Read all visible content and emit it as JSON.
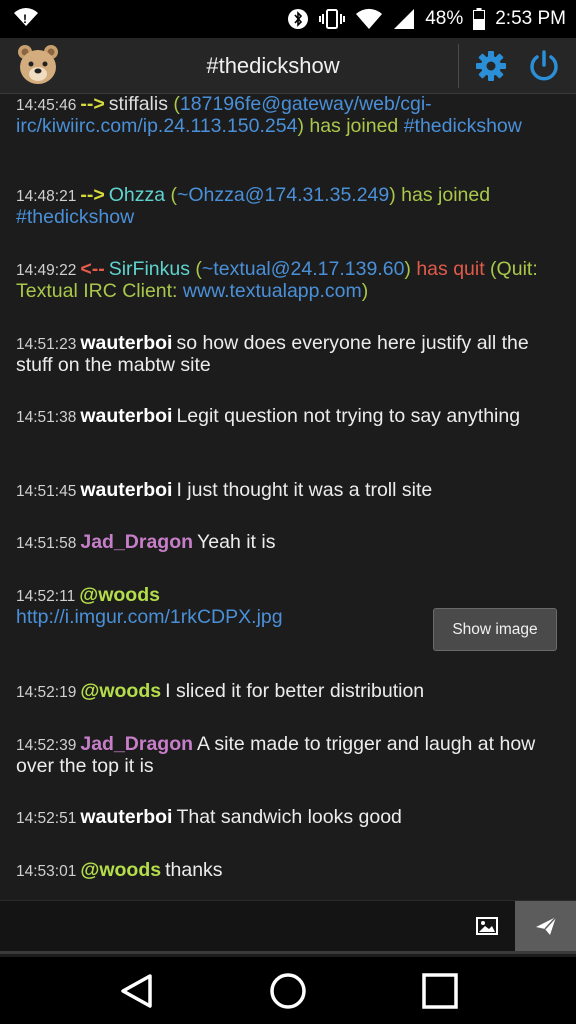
{
  "status_bar": {
    "battery": "48%",
    "time": "2:53 PM",
    "icons": [
      "wifi-icon",
      "bluetooth-icon",
      "vibrate-icon",
      "signal-wifi-icon",
      "cell-signal-icon",
      "battery-icon"
    ]
  },
  "header": {
    "channel": "#thedickshow",
    "logo_icon": "bear-logo-icon",
    "settings_icon": "gear-icon",
    "power_icon": "power-icon",
    "accent_color": "#2b8fd8"
  },
  "messages": [
    {
      "time": "14:45:46",
      "arrow": "-->",
      "nick": "stiffalis",
      "open": " (",
      "host": "187196fe@gateway/web/cgi-irc/kiwiirc.com/ip.24.113.150.254",
      "close": ")",
      "action": " has joined ",
      "channel": "#thedickshow"
    },
    {
      "time": "14:48:21",
      "arrow": "-->",
      "nick": "Ohzza",
      "open": " (",
      "host": "~Ohzza@174.31.35.249",
      "close": ")",
      "action": " has joined ",
      "channel": "#thedickshow"
    },
    {
      "time": "14:49:22",
      "arrow": "<--",
      "nick": "SirFinkus",
      "open": " (",
      "host": "~textual@24.17.139.60",
      "close": ")",
      "action": " has quit",
      "reason_pre": " (Quit: Textual IRC Client: ",
      "reason_link": "www.textualapp.com",
      "reason_post": ")"
    },
    {
      "time": "14:51:23",
      "nick": "wauterboi",
      "text": "so how does everyone here justify all the stuff on the mabtw site"
    },
    {
      "time": "14:51:38",
      "nick": "wauterboi",
      "text": "Legit question not trying to say anything"
    },
    {
      "time": "14:51:45",
      "nick": "wauterboi",
      "text": "I just thought it was a troll site"
    },
    {
      "time": "14:51:58",
      "nick": "Jad_Dragon",
      "text": "Yeah it is"
    },
    {
      "time": "14:52:11",
      "nick": "@woods",
      "link": "http://i.imgur.com/1rkCDPX.jpg",
      "button": "Show image"
    },
    {
      "time": "14:52:19",
      "nick": "@woods",
      "text": "I sliced it for better distribution"
    },
    {
      "time": "14:52:39",
      "nick": "Jad_Dragon",
      "text": "A site made to trigger and laugh at how over the top it is"
    },
    {
      "time": "14:52:51",
      "nick": "wauterboi",
      "text": "That sandwich looks good"
    },
    {
      "time": "14:53:01",
      "nick": "@woods",
      "text": "thanks"
    }
  ],
  "composer": {
    "placeholder": "",
    "image_icon": "image-icon",
    "send_icon": "send-icon"
  },
  "nav_bar": {
    "icons": [
      "back-icon",
      "home-icon",
      "recents-icon"
    ]
  }
}
